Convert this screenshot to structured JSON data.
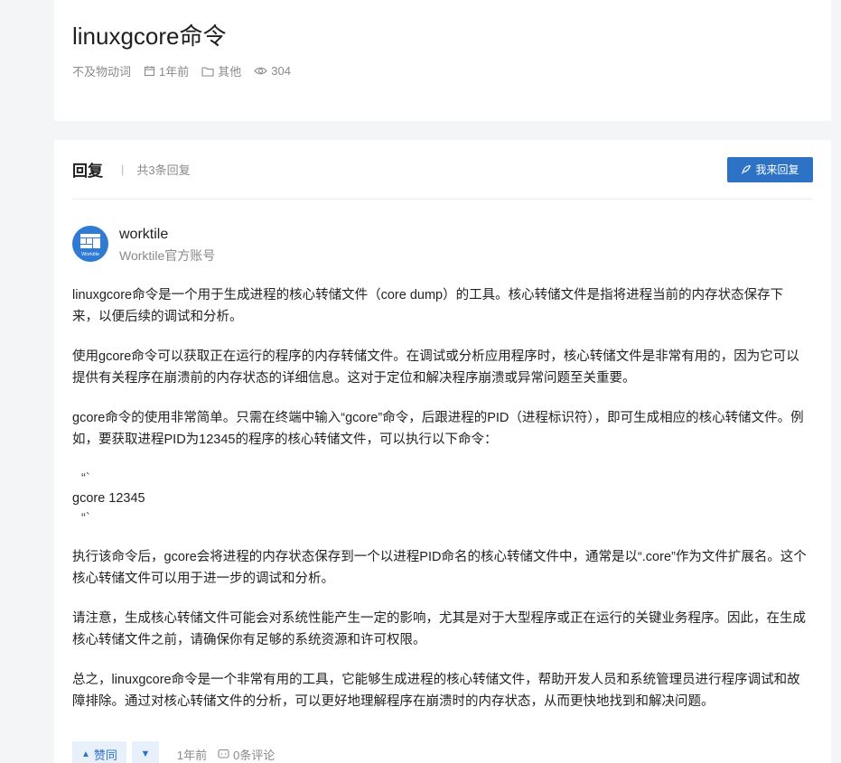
{
  "header": {
    "title": "linuxgcore命令",
    "meta": {
      "category_tag": "不及物动词",
      "time": "1年前",
      "folder": "其他",
      "views": "304"
    }
  },
  "replies": {
    "title": "回复",
    "count_text": "共3条回复",
    "reply_button": "我来回复"
  },
  "answer": {
    "author_name": "worktile",
    "author_role": "Worktile官方账号",
    "avatar_text": "Worktile",
    "paragraphs": [
      "linuxgcore命令是一个用于生成进程的核心转储文件（core dump）的工具。核心转储文件是指将进程当前的内存状态保存下来，以便后续的调试和分析。",
      "使用gcore命令可以获取正在运行的程序的内存转储文件。在调试或分析应用程序时，核心转储文件是非常有用的，因为它可以提供有关程序在崩溃前的内存状态的详细信息。这对于定位和解决程序崩溃或异常问题至关重要。",
      "gcore命令的使用非常简单。只需在终端中输入“gcore”命令，后跟进程的PID（进程标识符），即可生成相应的核心转储文件。例如，要获取进程PID为12345的程序的核心转储文件，可以执行以下命令：",
      "执行该命令后，gcore会将进程的内存状态保存到一个以进程PID命名的核心转储文件中，通常是以“.core”作为文件扩展名。这个核心转储文件可以用于进一步的调试和分析。",
      "请注意，生成核心转储文件可能会对系统性能产生一定的影响，尤其是对于大型程序或正在运行的关键业务程序。因此，在生成核心转储文件之前，请确保你有足够的系统资源和许可权限。",
      "总之，linuxgcore命令是一个非常有用的工具，它能够生成进程的核心转储文件，帮助开发人员和系统管理员进行程序调试和故障排除。通过对核心转储文件的分析，可以更好地理解程序在崩溃时的内存状态，从而更快地找到和解决问题。"
    ],
    "code": {
      "open_tick": "“`",
      "command": "gcore 12345",
      "close_tick": "“`"
    },
    "actions": {
      "upvote": "赞同",
      "time": "1年前",
      "comments": "0条评论"
    }
  },
  "colors": {
    "accent": "#2e72c6",
    "background": "#f4f5f7"
  }
}
